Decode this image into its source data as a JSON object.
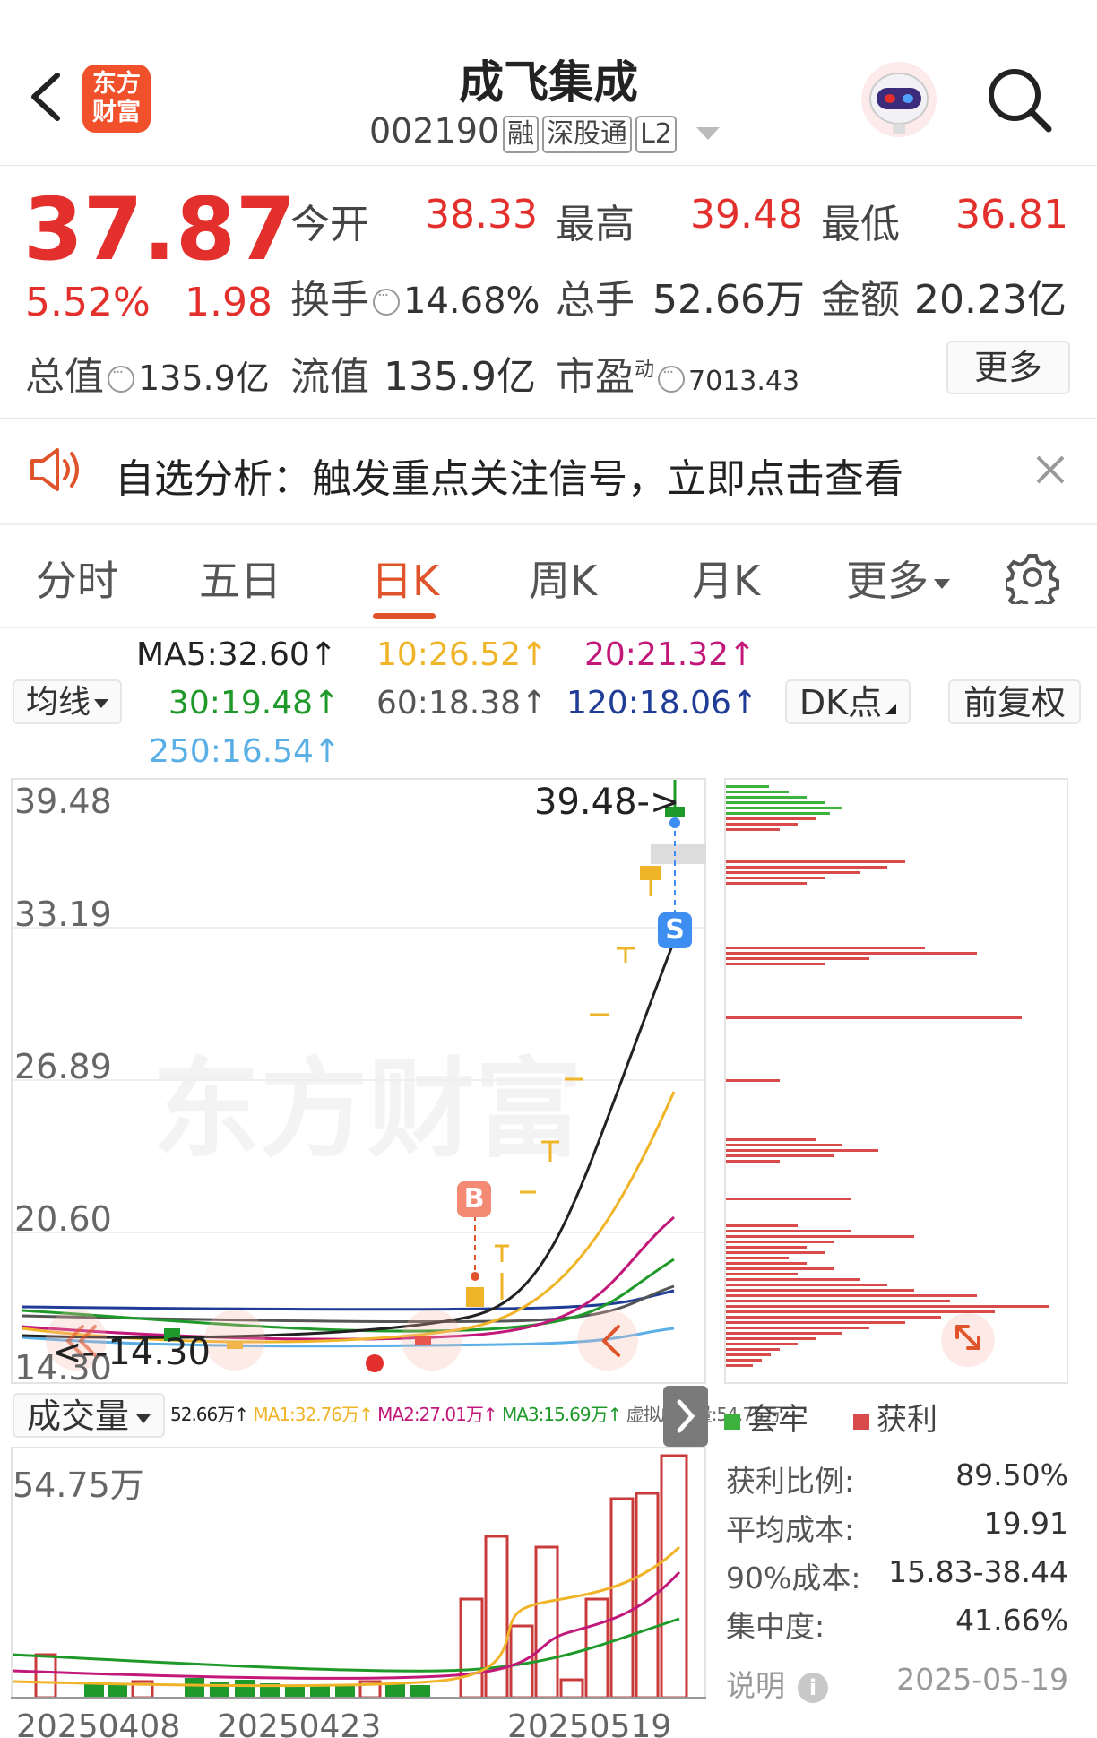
{
  "header": {
    "title": "成飞集成",
    "code": "002190",
    "tags": [
      "融",
      "深股通",
      "L2"
    ],
    "logo_text_1": "东方",
    "logo_text_2": "财富"
  },
  "quote": {
    "price": "37.87",
    "change_pct": "5.52%",
    "change": "1.98",
    "open_label": "今开",
    "open": "38.33",
    "high_label": "最高",
    "high": "39.48",
    "low_label": "最低",
    "low": "36.81",
    "turnover_label": "换手",
    "turnover": "14.68%",
    "volume_label": "总手",
    "volume": "52.66万",
    "amount_label": "金额",
    "amount": "20.23亿",
    "mcap_label": "总值",
    "mcap": "135.9亿",
    "float_label": "流值",
    "float": "135.9亿",
    "pe_label": "市盈",
    "pe_sup": "动",
    "pe": "7013.43",
    "more_button": "更多"
  },
  "notice": {
    "text": "自选分析：触发重点关注信号，立即点击查看"
  },
  "tabs": [
    "分时",
    "五日",
    "日K",
    "周K",
    "月K",
    "更多"
  ],
  "active_tab": 2,
  "ma_panel": {
    "selector": "均线",
    "ma5": "MA5:32.60↑",
    "ma10": "10:26.52↑",
    "ma20": "20:21.32↑",
    "ma30": "30:19.48↑",
    "ma60": "60:18.38↑",
    "ma120": "120:18.06↑",
    "ma250": "250:16.54↑",
    "dk_button": "DK点",
    "adjust_button": "前复权"
  },
  "kchart": {
    "y_labels": [
      "39.48",
      "33.19",
      "26.89",
      "20.60",
      "14.30"
    ],
    "max_marker": "39.48->",
    "min_marker": "<--14.30",
    "watermark": "东方财富",
    "buy_marker": "B",
    "sell_marker": "S"
  },
  "volume": {
    "selector": "成交量",
    "legend_vol": "52.66万↑",
    "legend_ma1": "MA1:32.76万↑",
    "legend_ma2": "MA2:27.01万↑",
    "legend_ma3": "MA3:15.69万↑",
    "legend_virtual": "虚拟成交量:54.75万",
    "max_label": "54.75万",
    "dates": [
      "20250408",
      "20250423",
      "20250519"
    ]
  },
  "chips": {
    "legend_trapped": "套牢",
    "legend_profit": "获利",
    "profit_ratio_label": "获利比例:",
    "profit_ratio": "89.50%",
    "avg_cost_label": "平均成本:",
    "avg_cost": "19.91",
    "cost90_label": "90%成本:",
    "cost90": "15.83-38.44",
    "concentration_label": "集中度:",
    "concentration": "41.66%",
    "note_label": "说明",
    "date": "2025-05-19"
  },
  "colors": {
    "up": "#e3302c",
    "down": "#1f9a2a",
    "accent": "#e0542c",
    "ma5": "#222222",
    "ma10": "#f0b429",
    "ma20": "#c2187a",
    "ma30": "#1f9a2a",
    "ma60": "#555555",
    "ma120": "#1f3c96",
    "ma250": "#5ab0e6"
  }
}
